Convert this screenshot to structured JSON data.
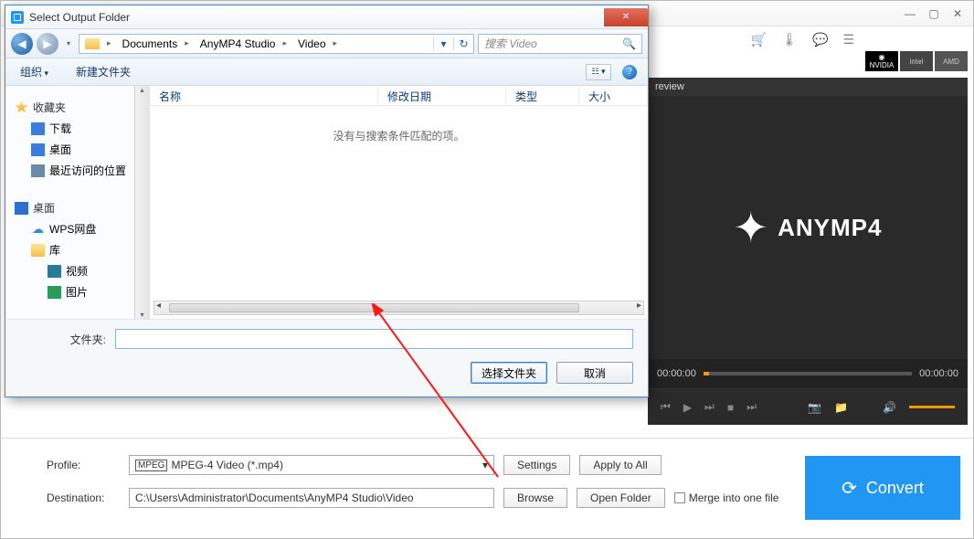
{
  "app": {
    "preview_label": "review",
    "brand": "ANYMP4",
    "time_left": "00:00:00",
    "time_right": "00:00:00",
    "profile_label": "Profile:",
    "profile_value": "MPEG-4 Video (*.mp4)",
    "settings_btn": "Settings",
    "apply_btn": "Apply to All",
    "dest_label": "Destination:",
    "dest_value": "C:\\Users\\Administrator\\Documents\\AnyMP4 Studio\\Video",
    "browse_btn": "Browse",
    "open_folder_btn": "Open Folder",
    "merge_label": "Merge into one file",
    "convert_btn": "Convert",
    "vendor_nvidia": "NVIDIA",
    "vendor_intel": "intel",
    "vendor_amd": "AMD"
  },
  "dlg": {
    "title": "Select Output Folder",
    "crumbs": [
      "Documents",
      "AnyMP4 Studio",
      "Video"
    ],
    "search_placeholder": "搜索 Video",
    "toolbar_organize": "组织",
    "toolbar_newfolder": "新建文件夹",
    "tree": {
      "favorites": "收藏夹",
      "downloads": "下载",
      "desktop": "桌面",
      "recent": "最近访问的位置",
      "desktop_group": "桌面",
      "wps": "WPS网盘",
      "library": "库",
      "videos": "视频",
      "pictures": "图片"
    },
    "columns": {
      "name": "名称",
      "date": "修改日期",
      "type": "类型",
      "size": "大小"
    },
    "empty_msg": "没有与搜索条件匹配的项。",
    "folder_label": "文件夹:",
    "folder_value": "",
    "btn_select": "选择文件夹",
    "btn_cancel": "取消"
  }
}
